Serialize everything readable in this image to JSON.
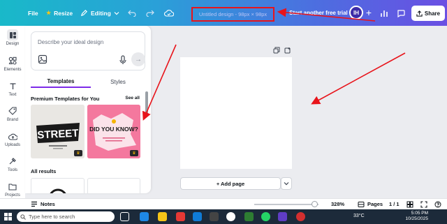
{
  "topbar": {
    "file_label": "File",
    "resize_label": "Resize",
    "editing_label": "Editing",
    "design_title": "Untitled design - 98px × 98px",
    "trial_label": "Start another free trial",
    "avatar_initials": "IH",
    "share_label": "Share"
  },
  "rail": {
    "items": [
      {
        "label": "Design",
        "icon": "design-icon"
      },
      {
        "label": "Elements",
        "icon": "elements-icon"
      },
      {
        "label": "Text",
        "icon": "text-icon"
      },
      {
        "label": "Brand",
        "icon": "brand-icon"
      },
      {
        "label": "Uploads",
        "icon": "uploads-icon"
      },
      {
        "label": "Tools",
        "icon": "tools-icon"
      },
      {
        "label": "Projects",
        "icon": "projects-icon"
      }
    ]
  },
  "panel": {
    "ai_placeholder": "Describe your ideal design",
    "tabs": [
      "Templates",
      "Styles"
    ],
    "premium_heading": "Premium Templates for You",
    "see_all_label": "See all",
    "all_results_heading": "All results",
    "thumb1_text": "STREET",
    "thumb2_text": "DID YOU KNOW?"
  },
  "canvas": {
    "add_page_label": "+ Add page"
  },
  "bottombar": {
    "notes_label": "Notes",
    "zoom_value": "328%",
    "zoom_fraction": 0.89,
    "pages_label": "Pages",
    "page_indicator": "1 / 1"
  },
  "taskbar": {
    "search_placeholder": "Type here to search",
    "temperature": "33°C",
    "time": "5:05 PM",
    "date": "10/25/2025"
  },
  "colors": {
    "accent_purple": "#7d2ae8",
    "highlight_red": "#e8141b",
    "gradient_start": "#19b9c9",
    "gradient_end": "#6a4fe3"
  }
}
